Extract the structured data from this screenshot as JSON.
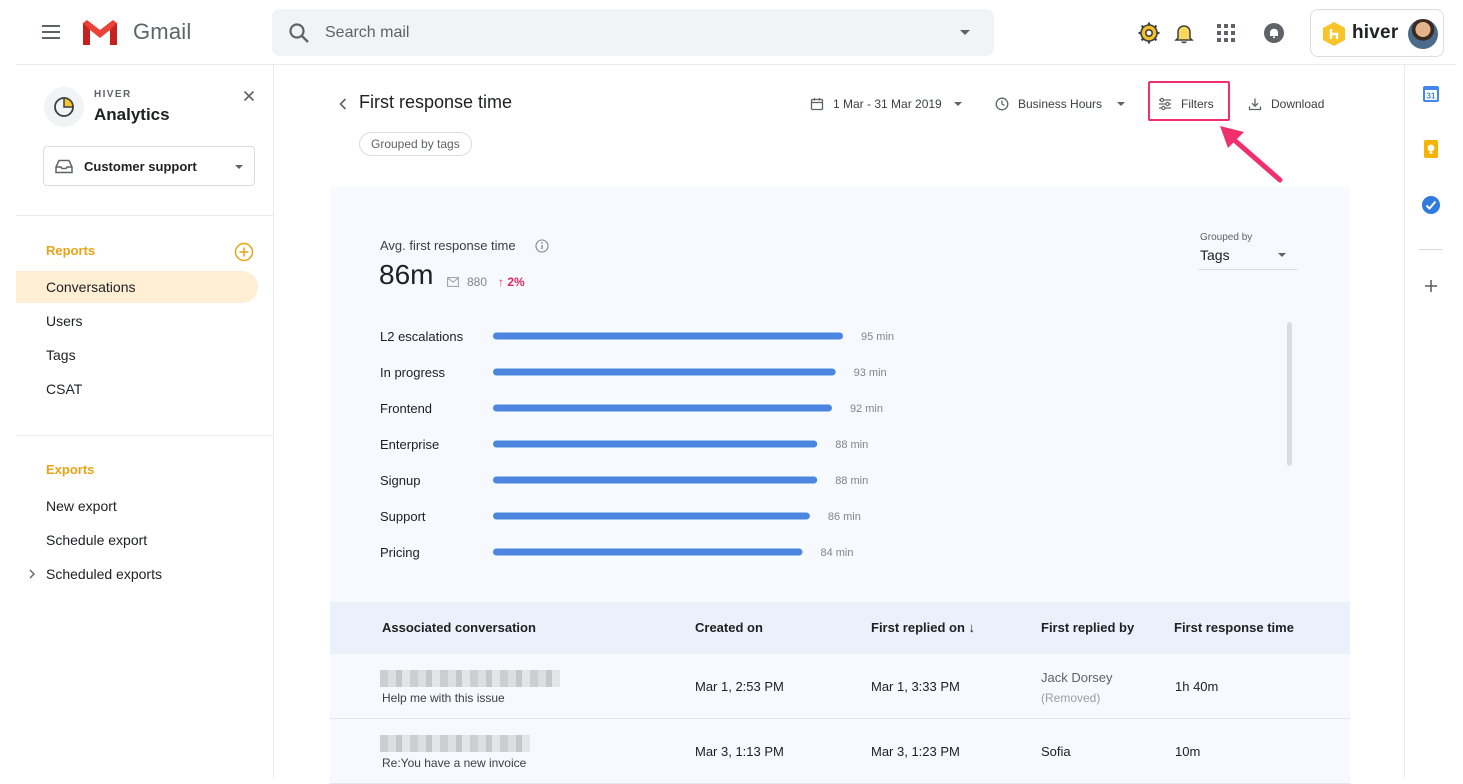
{
  "topbar": {
    "brand": "Gmail",
    "search_placeholder": "Search mail",
    "hiver_label": "hiver",
    "icons": [
      "menu-icon",
      "gmail-logo",
      "search-icon",
      "settings-icon",
      "bell-icon",
      "apps-grid-icon",
      "notifications-icon",
      "hiver-logo",
      "avatar"
    ]
  },
  "sidebar": {
    "brand_small": "HIVER",
    "brand_big": "Analytics",
    "inbox": "Customer support",
    "reports_title": "Reports",
    "reports": [
      "Conversations",
      "Users",
      "Tags",
      "CSAT"
    ],
    "active_report": "Conversations",
    "exports_title": "Exports",
    "exports": [
      "New export",
      "Schedule export",
      "Scheduled exports"
    ]
  },
  "header": {
    "title": "First response time",
    "group_chip": "Grouped by tags",
    "date_range": "1 Mar - 31 Mar 2019",
    "hours": "Business Hours",
    "filters": "Filters",
    "download": "Download"
  },
  "summary": {
    "label": "Avg. first response time",
    "value": "86m",
    "conversations": "880",
    "delta": "2%",
    "grouped_by_label": "Grouped by",
    "grouped_by_value": "Tags"
  },
  "chart_data": {
    "type": "bar",
    "orientation": "horizontal",
    "categories": [
      "L2 escalations",
      "In progress",
      "Frontend",
      "Enterprise",
      "Signup",
      "Support",
      "Pricing"
    ],
    "values": [
      95,
      93,
      92,
      88,
      88,
      86,
      84
    ],
    "value_labels": [
      "95 min",
      "93 min",
      "92 min",
      "88 min",
      "88 min",
      "86 min",
      "84 min"
    ],
    "xmax": 95,
    "color": "#4a86e0"
  },
  "table": {
    "columns": [
      "Associated conversation",
      "Created on",
      "First replied on ↓",
      "First replied by",
      "First response time"
    ],
    "rows": [
      {
        "subject": "Help me with this issue",
        "created": "Mar 1, 2:53 PM",
        "replied": "Mar 1, 3:33 PM",
        "by": "Jack Dorsey",
        "by_note": "(Removed)",
        "time": "1h 40m"
      },
      {
        "subject": "Re:You have a new invoice",
        "created": "Mar 3, 1:13 PM",
        "replied": "Mar 3, 1:23 PM",
        "by": "Sofia",
        "by_note": "",
        "time": "10m"
      }
    ]
  },
  "colors": {
    "accent": "#e8a317",
    "active_nav_bg": "#feefd4",
    "bar": "#4a86e0",
    "highlight": "#f0306c",
    "delta": "#e8245c"
  }
}
